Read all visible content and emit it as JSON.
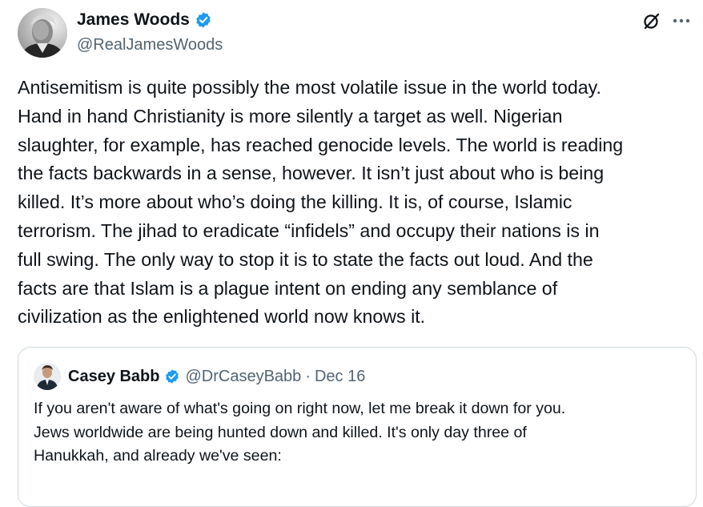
{
  "tweet": {
    "author": {
      "display_name": "James Woods",
      "handle": "@RealJamesWoods",
      "verified": true,
      "avatar_icon": "user-avatar-photo"
    },
    "header_icons": [
      "grok-icon",
      "more-icon"
    ],
    "text": "Antisemitism is quite possibly the most volatile issue in the world today.\nHand in hand Christianity is more silently a target as well. Nigerian\nslaughter, for example, has reached genocide levels. The world is reading\nthe facts backwards in a sense, however. It isn’t just about who is being\nkilled. It’s more about who’s doing the killing. It is, of course, Islamic\nterrorism. The jihad to eradicate “infidels” and occupy their nations is in\nfull swing. The only way to stop it is to state the facts out loud. And the\nfacts are that Islam is a plague intent on ending any semblance of\ncivilization as the enlightened world now knows it."
  },
  "quoted_tweet": {
    "author": {
      "display_name": "Casey Babb",
      "handle": "@DrCaseyBabb",
      "verified": true,
      "avatar_icon": "user-avatar-photo"
    },
    "separator": "·",
    "date": "Dec 16",
    "text": "If you aren't aware of what's going on right now, let me break it down for you.\nJews worldwide are being hunted down and killed. It's only day three of\nHanukkah, and already we've seen:"
  },
  "colors": {
    "text_primary": "#0f1419",
    "text_secondary": "#536471",
    "verified_badge": "#1d9bf0",
    "border": "#cfd9de"
  }
}
